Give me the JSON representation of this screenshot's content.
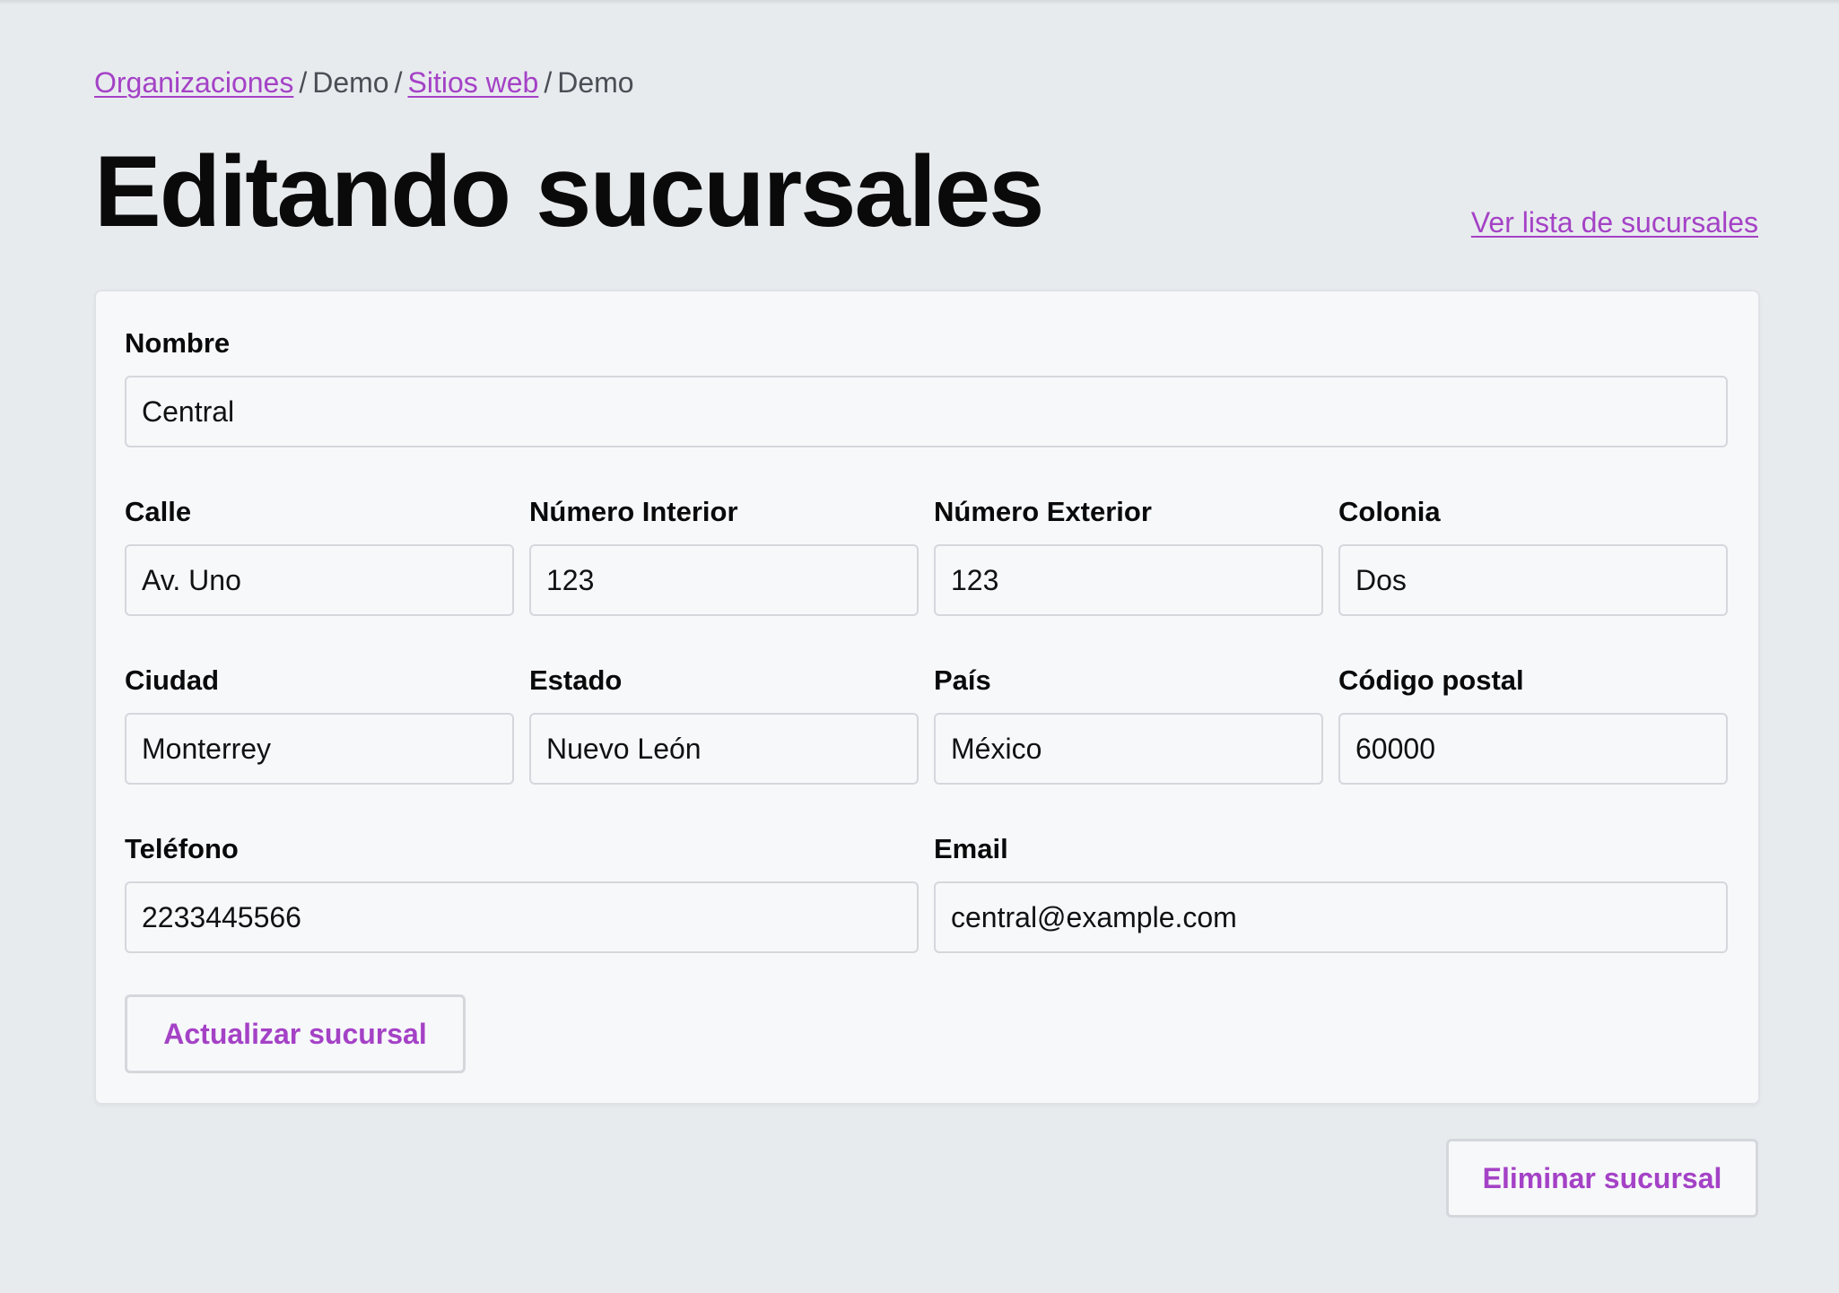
{
  "breadcrumb": {
    "items": [
      {
        "label": "Organizaciones",
        "link": true
      },
      {
        "label": "Demo",
        "link": false
      },
      {
        "label": "Sitios web",
        "link": true
      },
      {
        "label": "Demo",
        "link": false
      }
    ],
    "separator": "/"
  },
  "header": {
    "title": "Editando sucursales",
    "list_link": "Ver lista de sucursales"
  },
  "form": {
    "nombre": {
      "label": "Nombre",
      "value": "Central"
    },
    "calle": {
      "label": "Calle",
      "value": "Av. Uno"
    },
    "numero_interior": {
      "label": "Número Interior",
      "value": "123"
    },
    "numero_exterior": {
      "label": "Número Exterior",
      "value": "123"
    },
    "colonia": {
      "label": "Colonia",
      "value": "Dos"
    },
    "ciudad": {
      "label": "Ciudad",
      "value": "Monterrey"
    },
    "estado": {
      "label": "Estado",
      "value": "Nuevo León"
    },
    "pais": {
      "label": "País",
      "value": "México"
    },
    "codigo_postal": {
      "label": "Código postal",
      "value": "60000"
    },
    "telefono": {
      "label": "Teléfono",
      "value": "2233445566"
    },
    "email": {
      "label": "Email",
      "value": "central@example.com"
    },
    "submit_label": "Actualizar sucursal"
  },
  "actions": {
    "delete_label": "Eliminar sucursal"
  },
  "colors": {
    "accent": "#a442c6",
    "background": "#e8ebee",
    "card": "#f7f8fa",
    "border": "#d4d7dc"
  }
}
